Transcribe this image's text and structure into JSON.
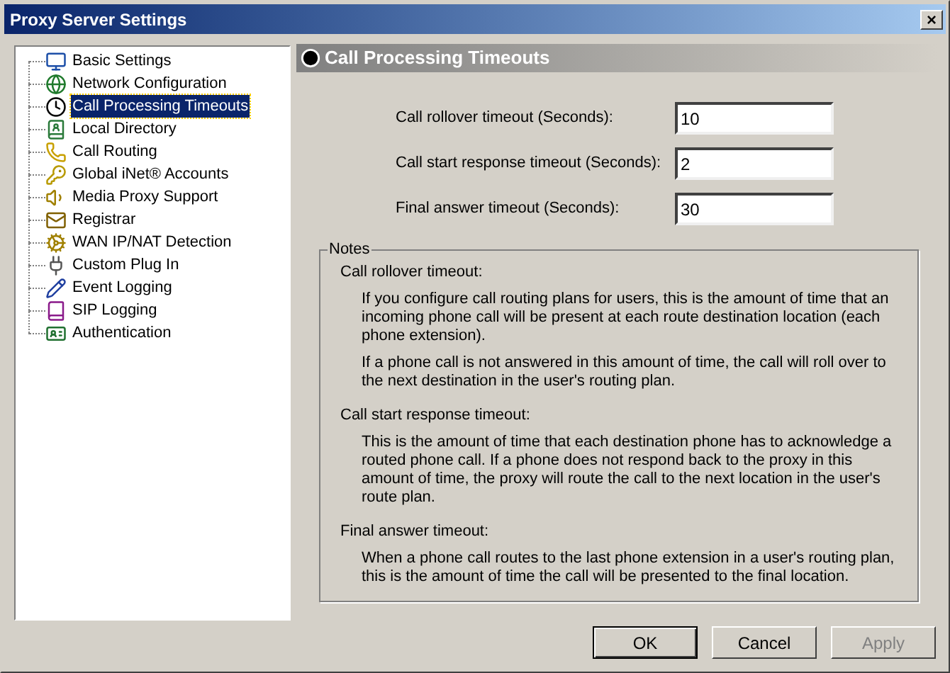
{
  "window": {
    "title": "Proxy Server Settings",
    "close": "×"
  },
  "tree": {
    "items": [
      {
        "label": "Basic Settings",
        "selected": false
      },
      {
        "label": "Network Configuration",
        "selected": false
      },
      {
        "label": "Call Processing Timeouts",
        "selected": true
      },
      {
        "label": "Local Directory",
        "selected": false
      },
      {
        "label": "Call Routing",
        "selected": false
      },
      {
        "label": "Global iNet® Accounts",
        "selected": false
      },
      {
        "label": "Media Proxy Support",
        "selected": false
      },
      {
        "label": "Registrar",
        "selected": false
      },
      {
        "label": "WAN IP/NAT Detection",
        "selected": false
      },
      {
        "label": "Custom Plug In",
        "selected": false
      },
      {
        "label": "Event Logging",
        "selected": false
      },
      {
        "label": "SIP Logging",
        "selected": false
      },
      {
        "label": "Authentication",
        "selected": false
      }
    ]
  },
  "panel": {
    "title": "Call Processing Timeouts",
    "fields": [
      {
        "label": "Call rollover timeout (Seconds):",
        "value": "10"
      },
      {
        "label": "Call start response timeout (Seconds):",
        "value": "2"
      },
      {
        "label": "Final answer timeout (Seconds):",
        "value": "30"
      }
    ],
    "notes": {
      "title": "Notes",
      "sections": [
        {
          "heading": "Call rollover timeout:",
          "paragraphs": [
            "If you configure call routing plans for users, this is the amount of time that an incoming phone call will be present at each route destination location (each phone extension).",
            "If a phone call is not answered in this amount of time, the call will roll over to the next destination in the user's routing plan."
          ]
        },
        {
          "heading": "Call start response timeout:",
          "paragraphs": [
            "This is the amount of time that each destination phone has to acknowledge a routed phone call. If a phone does not respond back to the proxy in this amount of time, the proxy will route the call to the next location in the user's route plan."
          ]
        },
        {
          "heading": "Final answer timeout:",
          "paragraphs": [
            "When a phone call routes to the last phone extension in a user's routing plan, this is the amount of time the call will be presented to the final location."
          ]
        }
      ]
    }
  },
  "buttons": [
    {
      "label": "OK",
      "default": true,
      "disabled": false
    },
    {
      "label": "Cancel",
      "default": false,
      "disabled": false
    },
    {
      "label": "Apply",
      "default": false,
      "disabled": true
    }
  ]
}
